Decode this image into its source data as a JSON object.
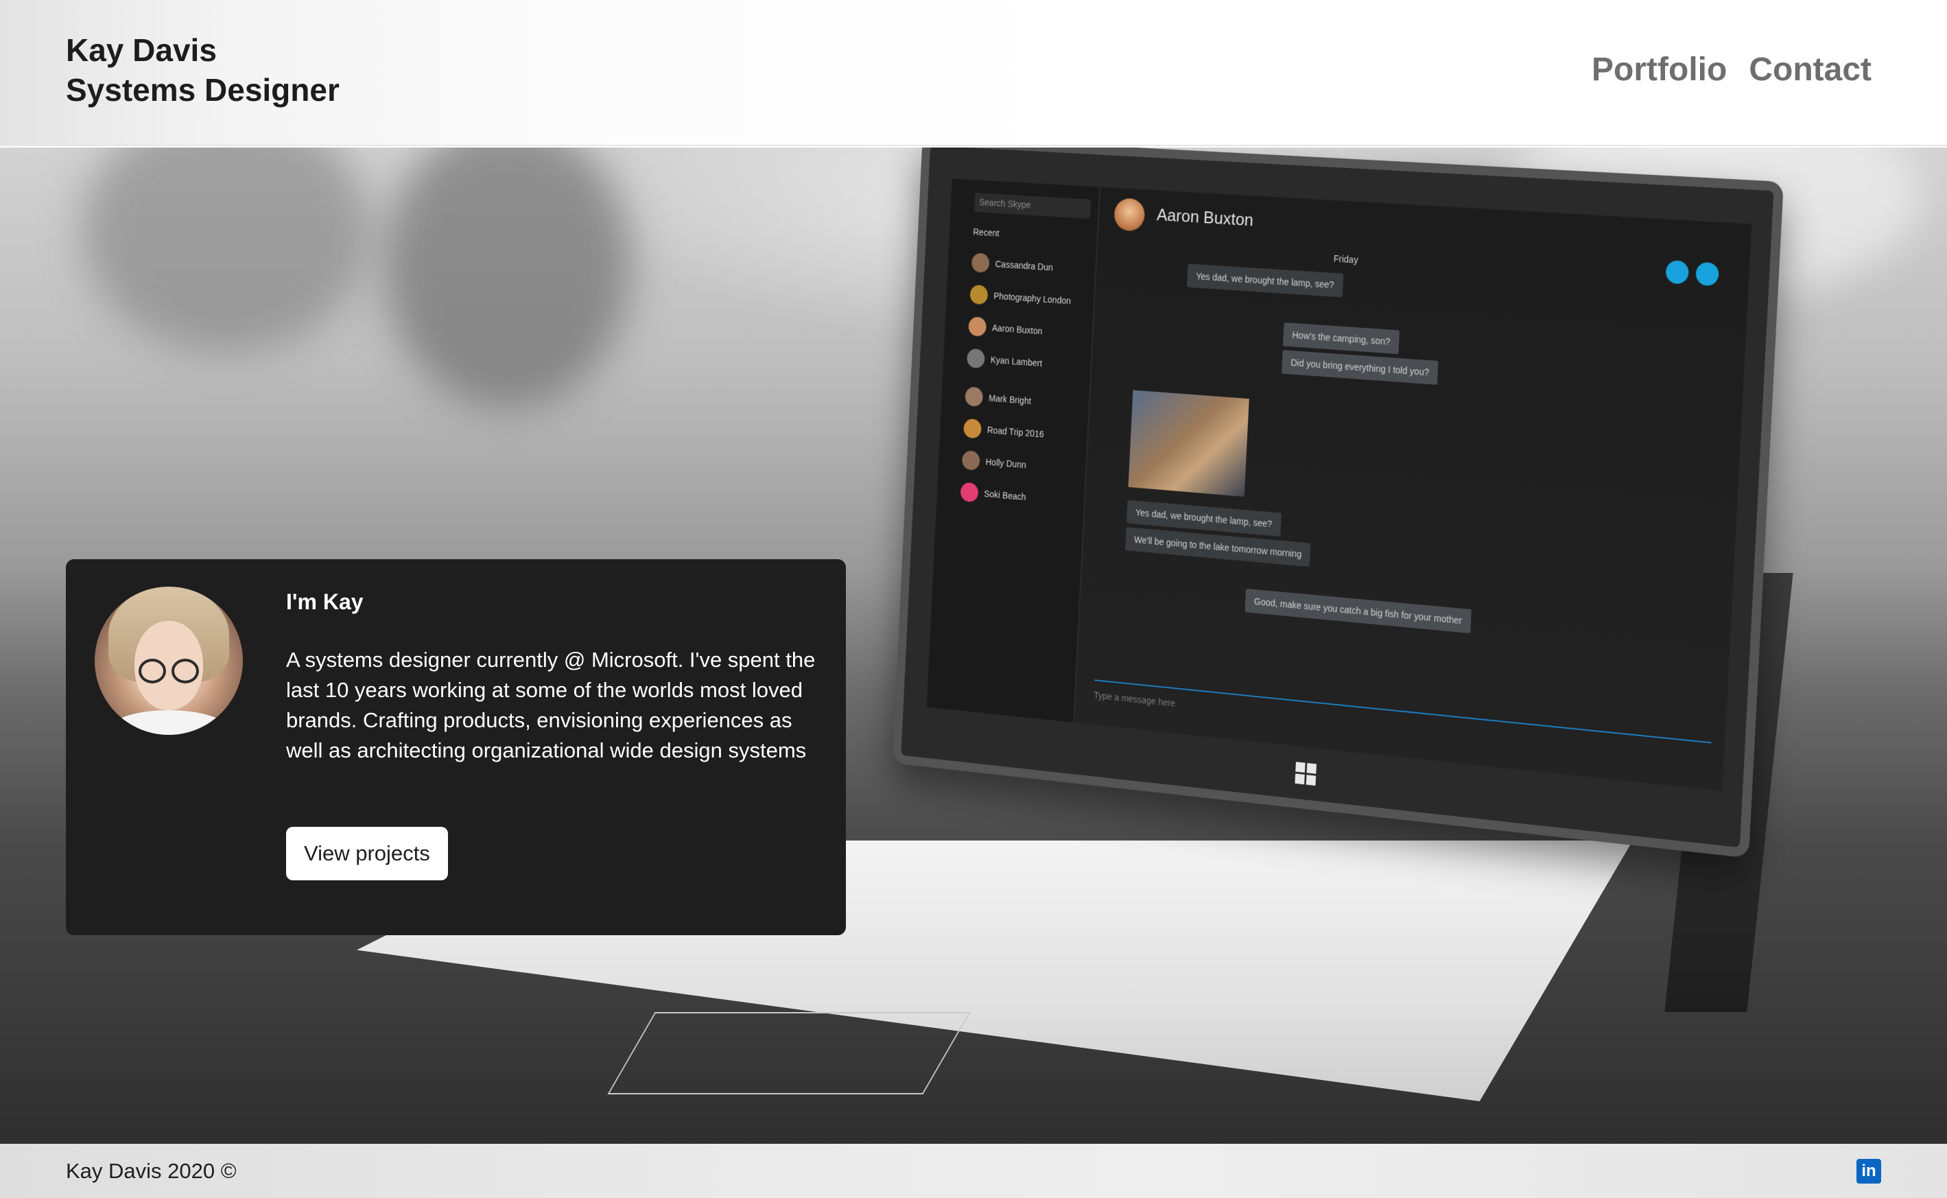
{
  "header": {
    "name": "Kay Davis",
    "role": "Systems Designer",
    "nav": {
      "portfolio": "Portfolio",
      "contact": "Contact"
    }
  },
  "intro": {
    "title": "I'm Kay",
    "body": "A systems designer currently @ Microsoft. I've spent the last 10 years working at some of the worlds most loved brands. Crafting products, envisioning experiences as well as architecting organizational wide design systems",
    "cta_label": "View projects"
  },
  "hero_device": {
    "search_placeholder": "Search Skype",
    "recent_label": "Recent",
    "contacts": [
      "Cassandra Dun",
      "Photography London",
      "Aaron Buxton",
      "Kyan Lambert",
      "Mark Bright",
      "Road Trip 2016",
      "Holly Dunn",
      "Soki Beach"
    ],
    "chat_name": "Aaron Buxton",
    "day_label": "Friday",
    "messages": [
      "Yes dad, we brought the lamp, see?",
      "How's the camping, son?",
      "Did you bring everything I told you?",
      "Yes dad, we brought the lamp, see?",
      "We'll be going to the lake tomorrow morning",
      "Good, make sure you catch a big fish for your mother"
    ],
    "compose_placeholder": "Type a message here"
  },
  "footer": {
    "copyright": "Kay Davis 2020 ©",
    "linkedin_icon": "linkedin-icon",
    "linkedin_glyph": "in"
  },
  "colors": {
    "card_bg": "#1e1e1e",
    "nav_text": "#6e6e6e",
    "linkedin": "#0a66c2"
  }
}
